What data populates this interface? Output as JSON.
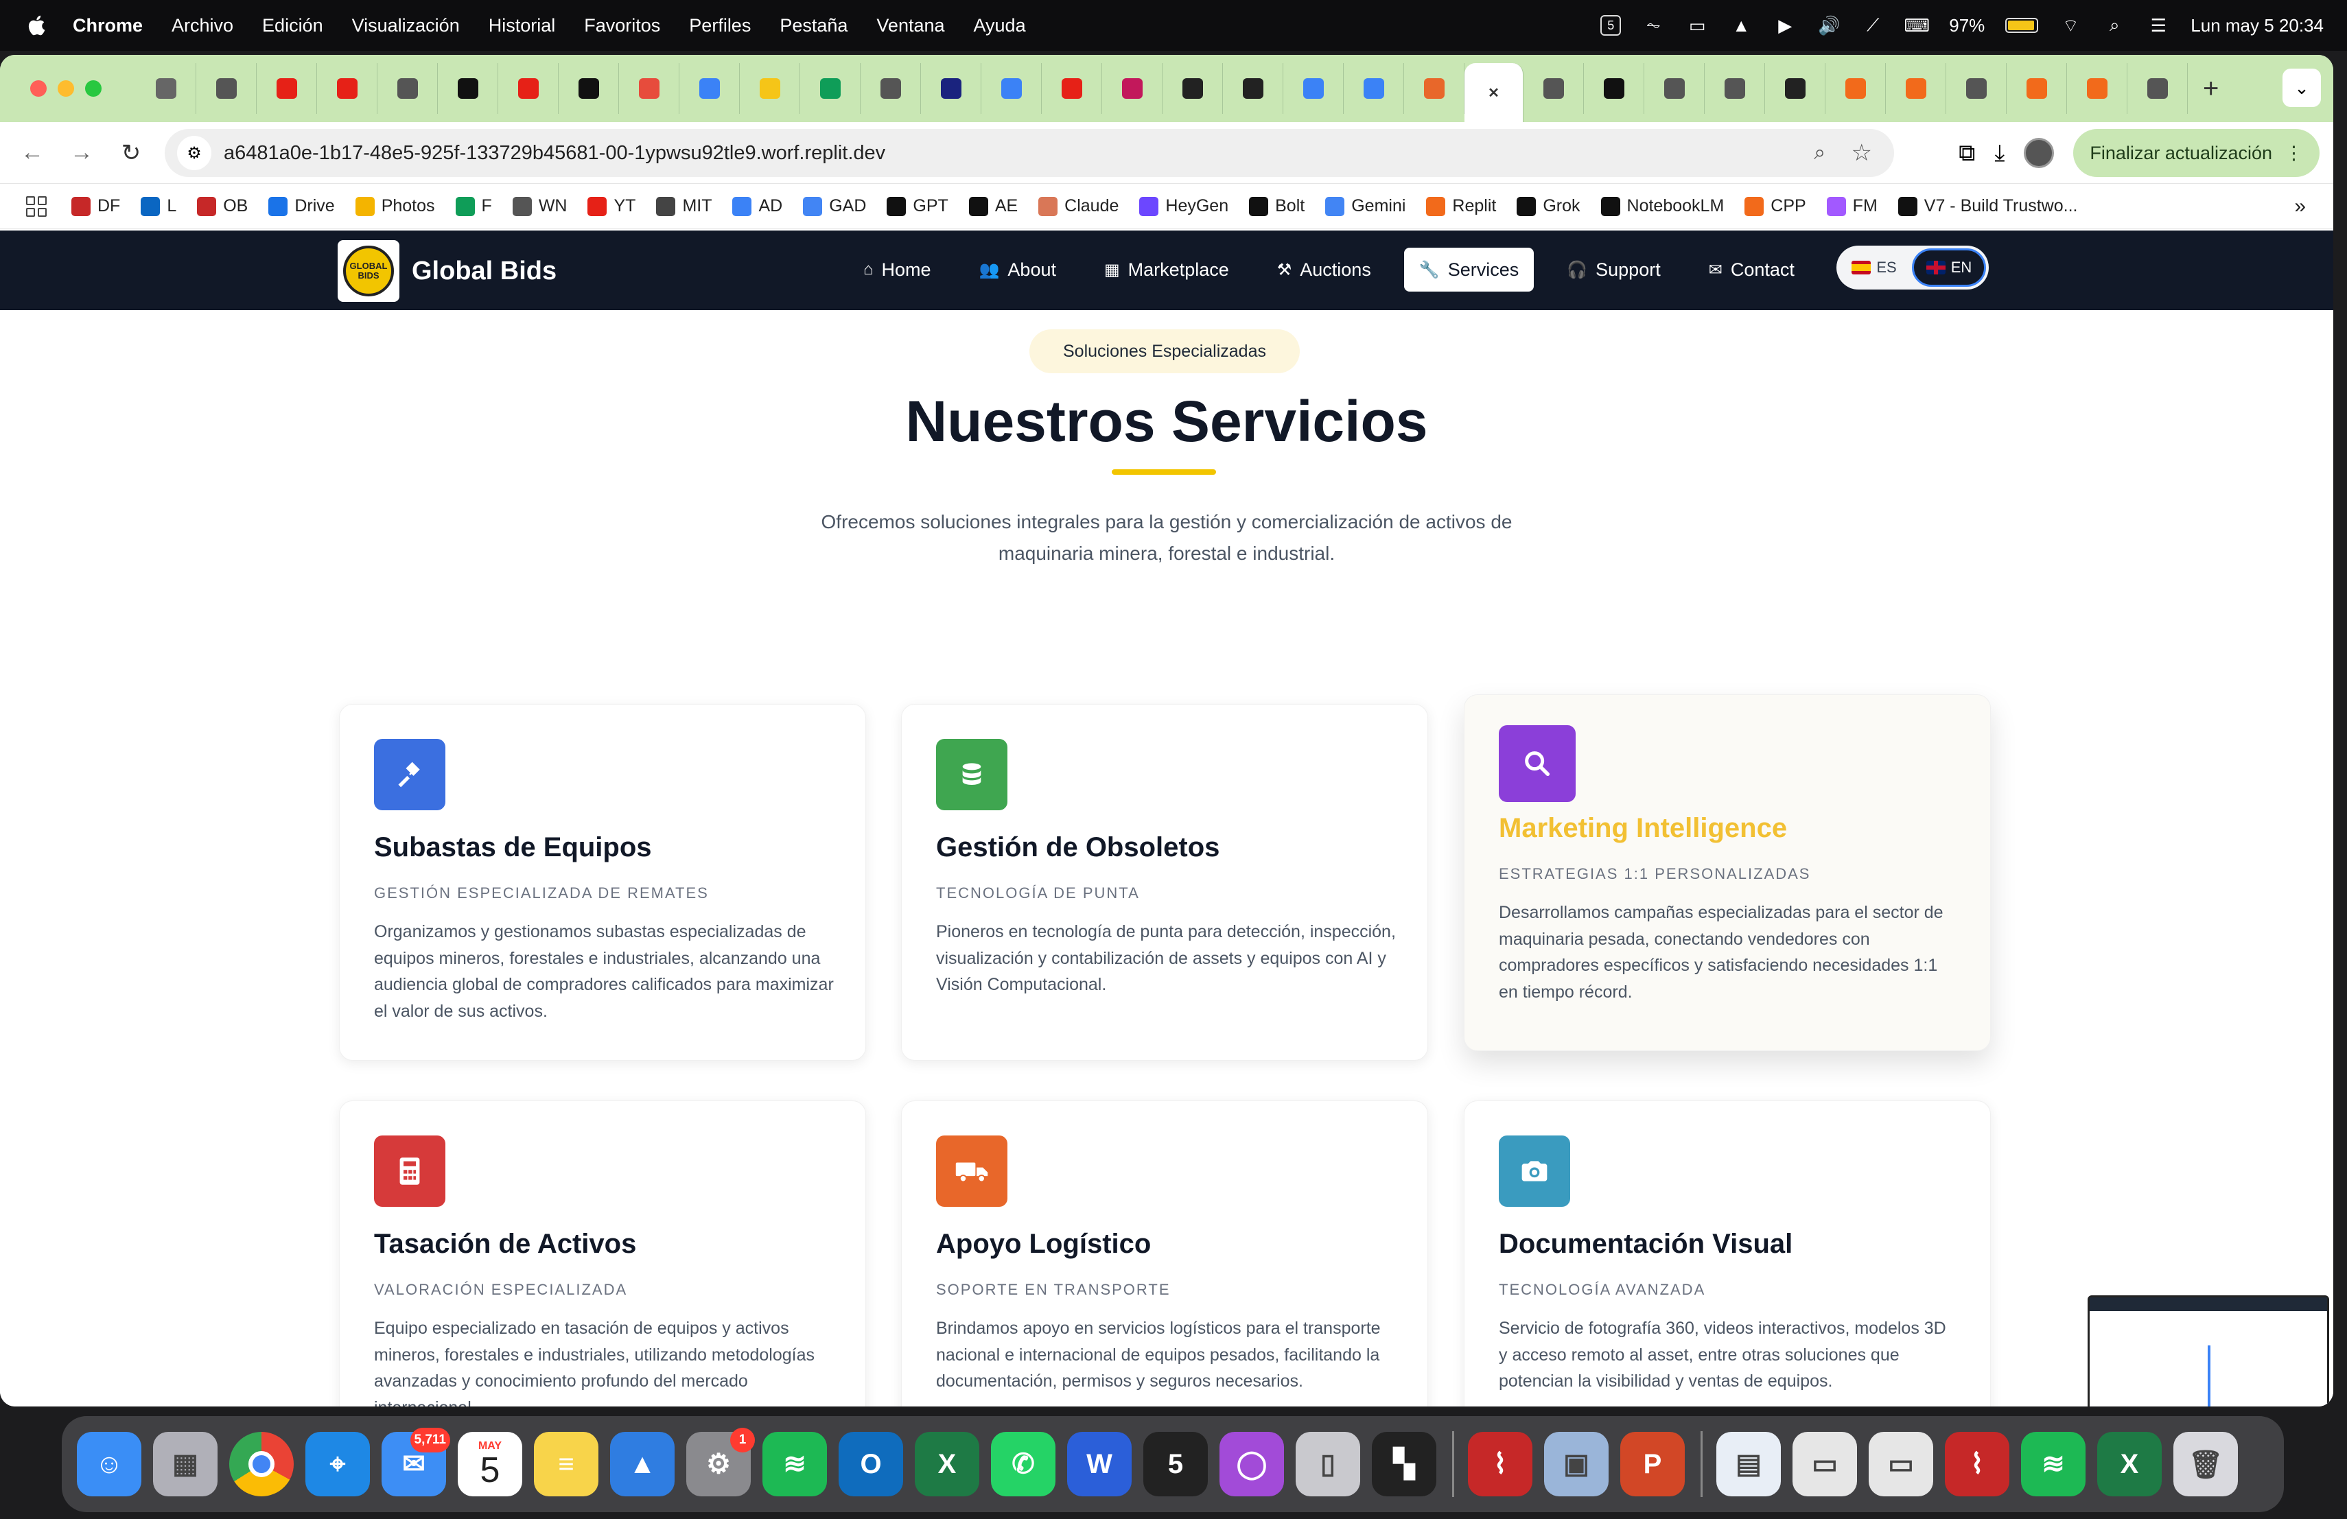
{
  "menubar": {
    "app_name": "Chrome",
    "menus": [
      "Archivo",
      "Edición",
      "Visualización",
      "Historial",
      "Favoritos",
      "Perfiles",
      "Pestaña",
      "Ventana",
      "Ayuda"
    ],
    "battery": "97%",
    "datetime": "Lun may 5  20:34"
  },
  "browser": {
    "url": "a6481a0e-1b17-48e5-925f-133729b45681-00-1ypwsu92tle9.worf.replit.dev",
    "update_label": "Finalizar actualización",
    "tab_count_visible": 35,
    "bookmarks": [
      "DF",
      "L",
      "OB",
      "Drive",
      "Photos",
      "F",
      "WN",
      "YT",
      "MIT",
      "AD",
      "GAD",
      "GPT",
      "AE",
      "Claude",
      "HeyGen",
      "Bolt",
      "Gemini",
      "Replit",
      "Grok",
      "NotebookLM",
      "CPP",
      "FM",
      "V7 - Build Trustwo..."
    ]
  },
  "site": {
    "brand": "Global Bids",
    "logo_text": "GLOBAL BIDS",
    "nav": [
      {
        "label": "Home",
        "icon": "home-icon"
      },
      {
        "label": "About",
        "icon": "users-icon"
      },
      {
        "label": "Marketplace",
        "icon": "grid-icon"
      },
      {
        "label": "Auctions",
        "icon": "gavel-icon"
      },
      {
        "label": "Services",
        "icon": "wrench-icon"
      },
      {
        "label": "Support",
        "icon": "headset-icon"
      },
      {
        "label": "Contact",
        "icon": "envelope-icon"
      }
    ],
    "active_nav": "Services",
    "lang": {
      "es": "ES",
      "en": "EN",
      "selected": "EN"
    }
  },
  "hero": {
    "pill": "Soluciones Especializadas",
    "title": "Nuestros Servicios",
    "subtitle": "Ofrecemos soluciones integrales para la gestión y comercialización de activos de maquinaria minera, forestal e industrial."
  },
  "services": [
    {
      "title": "Subastas de Equipos",
      "tag": "GESTIÓN ESPECIALIZADA DE REMATES",
      "desc": "Organizamos y gestionamos subastas especializadas de equipos mineros, forestales e industriales, alcanzando una audiencia global de compradores calificados para maximizar el valor de sus activos.",
      "icon": "gavel-icon",
      "color": "#3b6fe0"
    },
    {
      "title": "Gestión de Obsoletos",
      "tag": "TECNOLOGÍA DE PUNTA",
      "desc": "Pioneros en tecnología de punta para detección, inspección, visualización y contabilización de assets y equipos con AI y Visión Computacional.",
      "icon": "database-icon",
      "color": "#3fa650"
    },
    {
      "title": "Marketing Intelligence",
      "tag": "ESTRATEGIAS 1:1 PERSONALIZADAS",
      "desc": "Desarrollamos campañas especializadas para el sector de maquinaria pesada, conectando vendedores con compradores específicos y satisfaciendo necesidades 1:1 en tiempo récord.",
      "icon": "search-icon",
      "color": "#8b3fd9",
      "title_color": "#f2c033"
    },
    {
      "title": "Tasación de Activos",
      "tag": "VALORACIÓN ESPECIALIZADA",
      "desc": "Equipo especializado en tasación de equipos y activos mineros, forestales e industriales, utilizando metodologías avanzadas y conocimiento profundo del mercado internacional.",
      "icon": "calculator-icon",
      "color": "#d63a3a"
    },
    {
      "title": "Apoyo Logístico",
      "tag": "SOPORTE EN TRANSPORTE",
      "desc": "Brindamos apoyo en servicios logísticos para el transporte nacional e internacional de equipos pesados, facilitando la documentación, permisos y seguros necesarios.",
      "icon": "truck-icon",
      "color": "#e8672a"
    },
    {
      "title": "Documentación Visual",
      "tag": "TECNOLOGÍA AVANZADA",
      "desc": "Servicio de fotografía 360, videos interactivos, modelos 3D y acceso remoto al asset, entre otras soluciones que potencian la visibilidad y ventas de equipos.",
      "icon": "camera-icon",
      "color": "#3a9bbf"
    }
  ],
  "dock": {
    "mail_badge": "5,711",
    "settings_badge": "1",
    "calendar_month": "MAY",
    "calendar_day": "5"
  }
}
